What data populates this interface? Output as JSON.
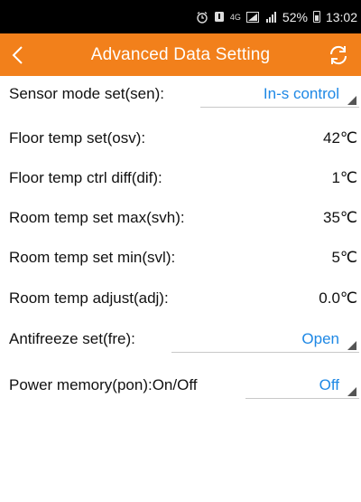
{
  "status_bar": {
    "alarm_icon": "alarm-clock-icon",
    "notification_icon": "notification-icon",
    "network": "4G",
    "battery": "52%",
    "time": "13:02"
  },
  "header": {
    "title": "Advanced Data Setting",
    "back_icon": "chevron-left-icon",
    "refresh_icon": "refresh-icon",
    "background_color": "#f2801b"
  },
  "settings": [
    {
      "label": "Sensor mode set(sen):",
      "value": "In-s control",
      "type": "dropdown"
    },
    {
      "label": "Floor temp set(osv):",
      "value": "42℃",
      "type": "value"
    },
    {
      "label": "Floor temp ctrl diff(dif):",
      "value": "1℃",
      "type": "value"
    },
    {
      "label": "Room temp set max(svh):",
      "value": "35℃",
      "type": "value"
    },
    {
      "label": "Room temp set min(svl):",
      "value": "5℃",
      "type": "value"
    },
    {
      "label": "Room temp adjust(adj):",
      "value": "0.0℃",
      "type": "value"
    },
    {
      "label": "Antifreeze set(fre):",
      "value": "Open",
      "type": "dropdown"
    },
    {
      "label": "Power memory(pon):On/Off",
      "value": "Off",
      "type": "dropdown"
    }
  ],
  "colors": {
    "accent": "#1e88e5",
    "divider": "#c8c8c8"
  }
}
